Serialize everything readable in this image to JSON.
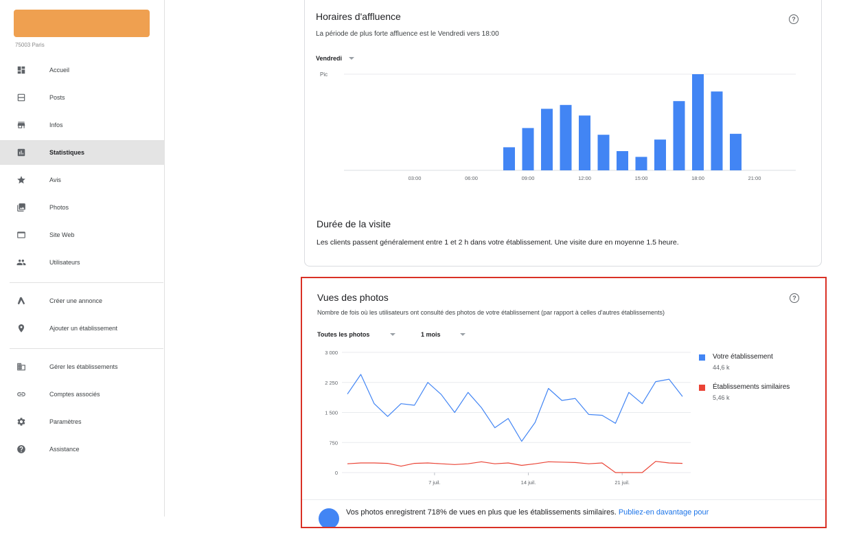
{
  "sidebar": {
    "address": "75003 Paris",
    "items": [
      {
        "label": "Accueil",
        "icon": "dashboard-icon"
      },
      {
        "label": "Posts",
        "icon": "posts-icon"
      },
      {
        "label": "Infos",
        "icon": "storefront-icon"
      },
      {
        "label": "Statistiques",
        "icon": "bar-chart-icon",
        "active": true
      },
      {
        "label": "Avis",
        "icon": "star-icon"
      },
      {
        "label": "Photos",
        "icon": "photos-icon"
      },
      {
        "label": "Site Web",
        "icon": "website-icon"
      },
      {
        "label": "Utilisateurs",
        "icon": "users-icon"
      },
      {
        "label": "Créer une annonce",
        "icon": "ads-icon"
      },
      {
        "label": "Ajouter un établissement",
        "icon": "location-pin-icon"
      },
      {
        "label": "Gérer les établissements",
        "icon": "buildings-icon"
      },
      {
        "label": "Comptes associés",
        "icon": "link-icon"
      },
      {
        "label": "Paramètres",
        "icon": "gear-icon"
      },
      {
        "label": "Assistance",
        "icon": "help-circle-icon"
      }
    ]
  },
  "affluence": {
    "title": "Horaires d'affluence",
    "subtitle": "La période de plus forte affluence est le Vendredi vers 18:00",
    "day_selector": "Vendredi",
    "help_glyph": "?",
    "duration_title": "Durée de la visite",
    "duration_text": "Les clients passent généralement entre 1 et 2 h dans votre établissement. Une visite dure en moyenne 1.5 heure."
  },
  "photos": {
    "title": "Vues des photos",
    "subtitle": "Nombre de fois où les utilisateurs ont consulté des photos de votre établissement (par rapport à celles d'autres établissements)",
    "filter_photos": "Toutes les photos",
    "filter_period": "1 mois",
    "help_glyph": "?",
    "legend": [
      {
        "name": "Votre établissement",
        "value": "44,6 k",
        "color": "#4285f4"
      },
      {
        "name": "Établissements similaires",
        "value": "5,46 k",
        "color": "#ea4335"
      }
    ],
    "insight_text": "Vos photos enregistrent 718% de vues en plus que les établissements similaires. ",
    "insight_link": "Publiez-en davantage pour"
  },
  "chart_data": [
    {
      "type": "bar",
      "peak_label": "Pic",
      "x_ticks": [
        "03:00",
        "06:00",
        "09:00",
        "12:00",
        "15:00",
        "18:00",
        "21:00"
      ],
      "categories": [
        "08:00",
        "09:00",
        "10:00",
        "11:00",
        "12:00",
        "13:00",
        "14:00",
        "15:00",
        "16:00",
        "17:00",
        "18:00",
        "19:00",
        "20:00"
      ],
      "values": [
        24,
        44,
        64,
        68,
        57,
        37,
        20,
        14,
        32,
        72,
        100,
        82,
        38
      ],
      "ylim": [
        0,
        100
      ],
      "color": "#4285f4"
    },
    {
      "type": "line",
      "y_ticks": [
        "3 000",
        "2 250",
        "1 500",
        "750",
        "0"
      ],
      "ylim": [
        0,
        3000
      ],
      "x_ticks": [
        "7 juil.",
        "14 juil.",
        "21 juil."
      ],
      "x_tick_index": [
        7,
        14,
        21
      ],
      "series": [
        {
          "name": "Votre établissement",
          "color": "#4285f4",
          "values": [
            1960,
            2450,
            1720,
            1400,
            1720,
            1680,
            2250,
            1950,
            1500,
            2000,
            1620,
            1120,
            1350,
            780,
            1250,
            2100,
            1800,
            1850,
            1450,
            1430,
            1230,
            2000,
            1720,
            2270,
            2330,
            1900
          ]
        },
        {
          "name": "Établissements similaires",
          "color": "#ea4335",
          "values": [
            220,
            240,
            240,
            230,
            160,
            230,
            240,
            220,
            200,
            220,
            270,
            220,
            240,
            180,
            220,
            270,
            260,
            250,
            220,
            240,
            0,
            0,
            0,
            280,
            240,
            230
          ]
        }
      ]
    }
  ]
}
